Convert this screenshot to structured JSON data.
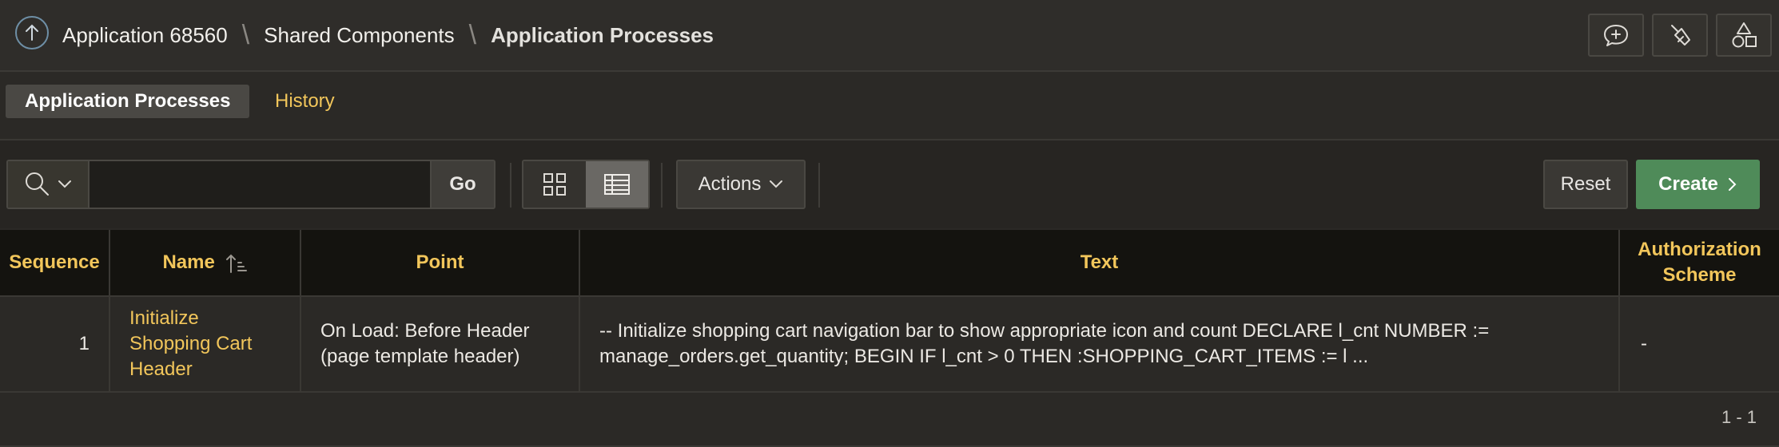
{
  "breadcrumb": {
    "items": [
      "Application 68560",
      "Shared Components"
    ],
    "current": "Application Processes"
  },
  "tabs": [
    {
      "label": "Application Processes",
      "active": true
    },
    {
      "label": "History",
      "active": false
    }
  ],
  "toolbar": {
    "search_value": "",
    "go_label": "Go",
    "actions_label": "Actions",
    "reset_label": "Reset",
    "create_label": "Create",
    "view_mode": "report"
  },
  "table": {
    "columns": [
      "Sequence",
      "Name",
      "Point",
      "Text",
      "Authorization Scheme"
    ],
    "rows": [
      {
        "sequence": "1",
        "name": "Initialize Shopping Cart Header",
        "point": "On Load: Before Header (page template header)",
        "text": "-- Initialize shopping cart navigation bar to show appropriate icon and count DECLARE l_cnt NUMBER := manage_orders.get_quantity; BEGIN IF l_cnt > 0 THEN :SHOPPING_CART_ITEMS := l ...",
        "authorization": "-"
      }
    ]
  },
  "pagination": "1 - 1",
  "colors": {
    "accent": "#f2c65b",
    "create": "#4f8b59",
    "background": "#2b2926",
    "header_bg": "#14130f"
  },
  "icons": [
    "up-arrow-icon",
    "feedback-icon",
    "sweep-icon",
    "shapes-icon",
    "search-icon",
    "chevron-down-icon",
    "grid-view-icon",
    "report-view-icon",
    "chevron-right-icon",
    "sort-ascending-icon"
  ]
}
